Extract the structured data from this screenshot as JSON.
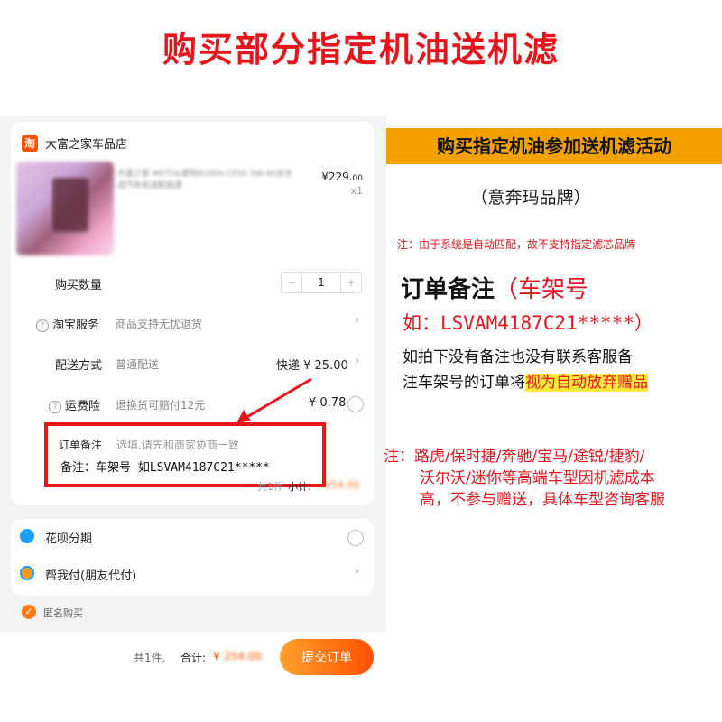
{
  "title": "购买部分指定机油送机滤",
  "shop": {
    "icon_glyph": "淘",
    "name": "大富之家车品店"
  },
  "product": {
    "desc": "共富之家 MOTUL摩特8100X-CESS 5W-40全合成汽车机油新能源",
    "price_main": "¥229.",
    "price_cents": "00",
    "qty_label": "x1"
  },
  "rows": {
    "quantity": {
      "label": "购买数量",
      "minus": "−",
      "value": "1",
      "plus": "+"
    },
    "service": {
      "label": "淘宝服务",
      "value": "商品支持无忧退货"
    },
    "delivery": {
      "label": "配送方式",
      "value": "普通配送",
      "price": "快递 ¥ 25.00"
    },
    "insurance": {
      "label": "运费险",
      "value": "退换货可赔付12元",
      "price": "¥ 0.78"
    },
    "remark": {
      "label": "订单备注",
      "placeholder": "选填,请先和商家协商一致",
      "text": "备注：车架号 如LSVAM4187C21*****"
    },
    "summary": {
      "count": "共1件",
      "subtotal_label": "小计:",
      "subtotal_value": "254.00"
    }
  },
  "payment": {
    "huabei": "花呗分期",
    "friend_pay": "帮我付(朋友代付)",
    "anonymous": "匿名购买"
  },
  "bottom": {
    "count": "共1件,",
    "total_label": "合计:",
    "currency": "¥",
    "total_value": "254.00",
    "submit": "提交订单"
  },
  "info": {
    "banner": "购买指定机油参加送机滤活动",
    "brand": "（意奔玛品牌）",
    "note1": "注：由于系统是自动匹配，故不支持指定滤芯品牌",
    "order_note_label": "订单备注",
    "order_note_paren": "（车架号",
    "order_note_example": "如：LSVAM4187C21*****）",
    "warn_line1": "如拍下没有备注也没有联系客服备",
    "warn_line2": "注车架号的订单将",
    "warn_highlight": "视为自动放弃赠品",
    "warn2_line1": "注：路虎/保时捷/奔驰/宝马/途锐/捷豹/",
    "warn2_line2": "沃尔沃/迷你等高端车型因机滤成本",
    "warn2_line3": "高，不参与赠送，具体车型咨询客服"
  },
  "colors": {
    "accent_red": "#e8141c",
    "orange": "#ff5000",
    "banner": "#f2a100",
    "highlight": "#ffe83a"
  }
}
